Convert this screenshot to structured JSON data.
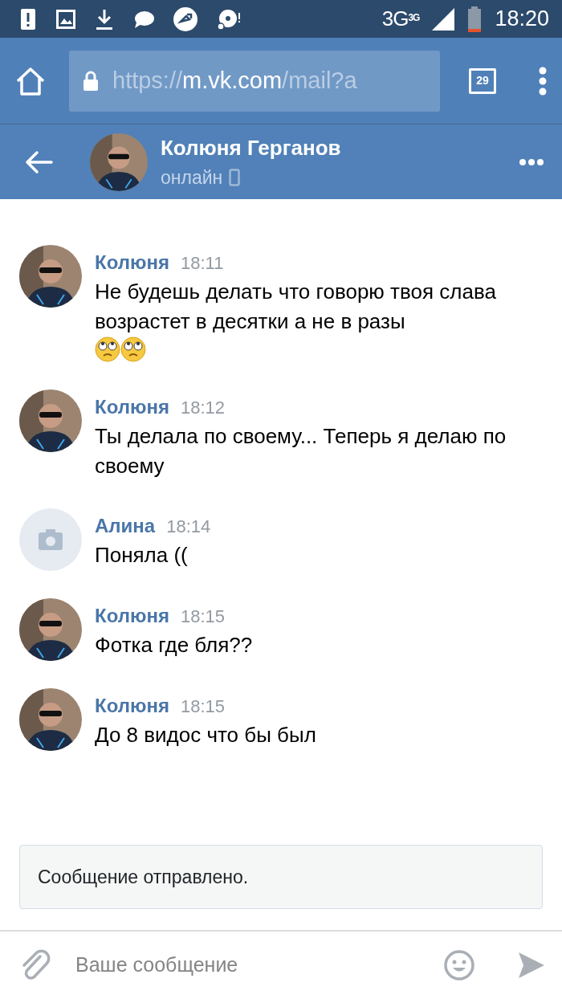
{
  "status_bar": {
    "network": "3G",
    "network_badge": "3G",
    "time": "18:20"
  },
  "browser": {
    "url_scheme": "https://",
    "url_host": "m.vk.com",
    "url_path": "/mail?a",
    "tab_count": "29"
  },
  "chat_header": {
    "name": "Колюня Герганов",
    "status": "онлайн",
    "mobile": true
  },
  "messages": [
    {
      "author": "Колюня",
      "time": "18:11",
      "text": "Не будешь делать что говорю твоя слава возрастет в десятки а не в разы",
      "kind": "photo",
      "emoji": true
    },
    {
      "author": "Колюня",
      "time": "18:12",
      "text": "Ты делала по своему... Теперь я делаю по своему",
      "kind": "photo"
    },
    {
      "author": "Алина",
      "time": "18:14",
      "text": "Поняла ((",
      "kind": "camera"
    },
    {
      "author": "Колюня",
      "time": "18:15",
      "text": "Фотка где бля??",
      "kind": "photo"
    },
    {
      "author": "Колюня",
      "time": "18:15",
      "text": "До 8 видос что бы был",
      "kind": "photo"
    }
  ],
  "notice": "Сообщение отправлено.",
  "composer": {
    "placeholder": "Ваше сообщение"
  }
}
